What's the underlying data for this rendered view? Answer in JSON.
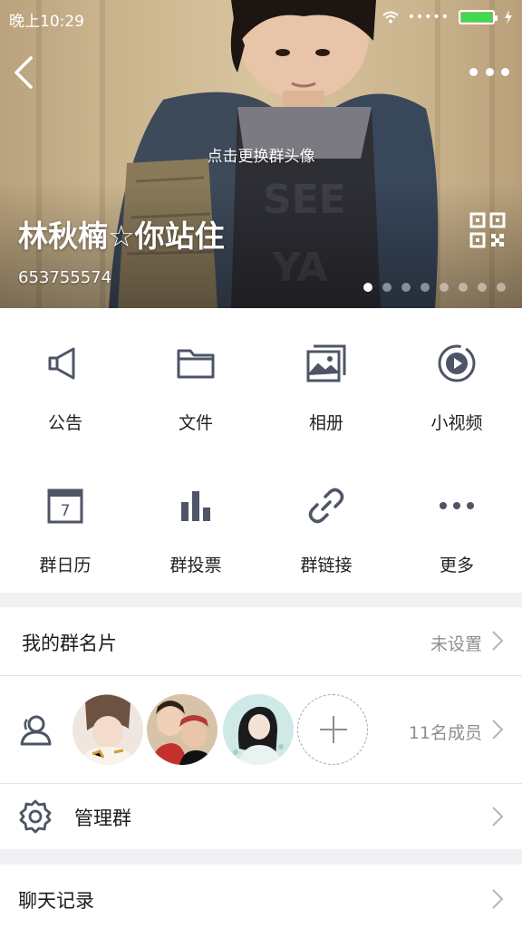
{
  "status_bar": {
    "time": "晚上10:29",
    "signal_dots": "•••••",
    "battery_level": 1.0,
    "battery_color": "#3ddc4e"
  },
  "header": {
    "change_avatar_label": "点击更换群头像",
    "group_name": "林秋楠☆你站住",
    "group_id": "653755574",
    "carousel": {
      "total": 8,
      "active_index": 0
    },
    "icons": {
      "back": "back-chevron-icon",
      "more": "more-dots-icon",
      "qr": "qr-code-icon"
    }
  },
  "features": [
    {
      "label": "公告",
      "icon": "megaphone-icon"
    },
    {
      "label": "文件",
      "icon": "folder-icon"
    },
    {
      "label": "相册",
      "icon": "photo-album-icon"
    },
    {
      "label": "小视频",
      "icon": "video-play-icon"
    },
    {
      "label": "群日历",
      "icon": "calendar-icon",
      "calendar_day": "7"
    },
    {
      "label": "群投票",
      "icon": "bar-chart-icon"
    },
    {
      "label": "群链接",
      "icon": "link-icon"
    },
    {
      "label": "更多",
      "icon": "more-icon"
    }
  ],
  "my_card": {
    "title": "我的群名片",
    "value": "未设置"
  },
  "members": {
    "count_label": "11名成员",
    "icon": "members-icon",
    "avatars": [
      "avatar-1",
      "avatar-2",
      "avatar-3"
    ]
  },
  "manage": {
    "title": "管理群",
    "icon": "gear-icon"
  },
  "chat_history": {
    "title": "聊天记录"
  },
  "colors": {
    "icon_gray": "#4e5566",
    "accent_green": "#3ddc4e",
    "page_bg": "#f1f1f4"
  }
}
